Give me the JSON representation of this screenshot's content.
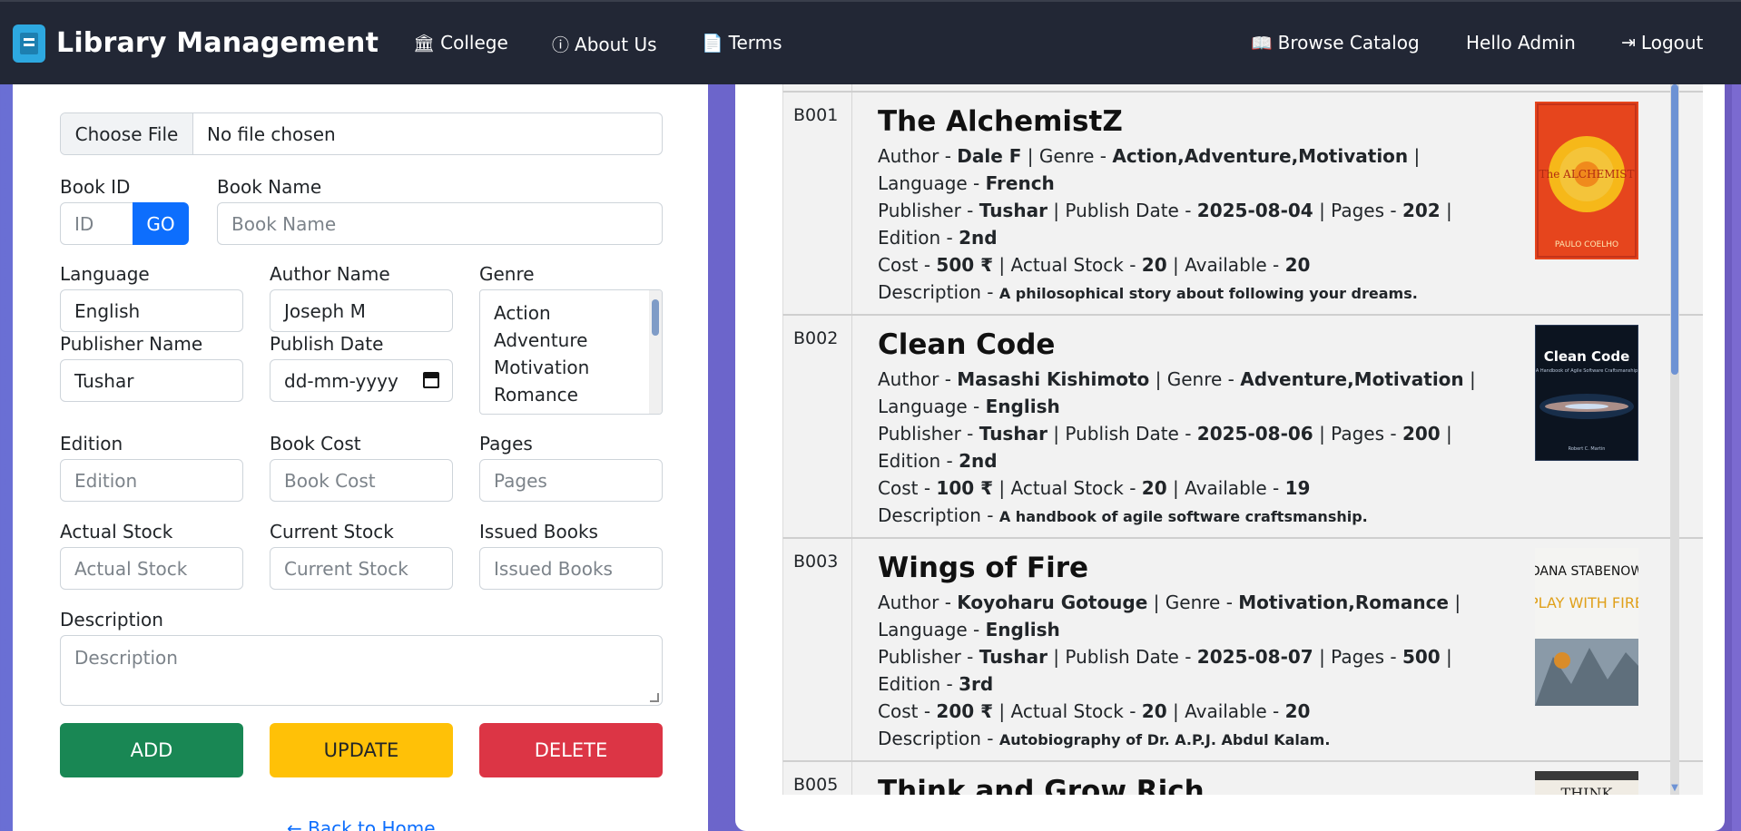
{
  "navbar": {
    "brand": "Library Management",
    "links": [
      {
        "label": "College",
        "icon": "bank-icon"
      },
      {
        "label": "About Us",
        "icon": "info-circle-icon"
      },
      {
        "label": "Terms",
        "icon": "file-text-icon"
      }
    ],
    "browse": "Browse Catalog",
    "greeting": "Hello Admin",
    "logout": "Logout"
  },
  "form": {
    "file_button": "Choose File",
    "file_status": "No file chosen",
    "book_id_label": "Book ID",
    "book_id_placeholder": "ID",
    "go_button": "GO",
    "book_name_label": "Book Name",
    "book_name_placeholder": "Book Name",
    "language_label": "Language",
    "language_value": "English",
    "author_label": "Author Name",
    "author_value": "Joseph M",
    "genre_label": "Genre",
    "genre_options": [
      "Action",
      "Adventure",
      "Motivation",
      "Romance"
    ],
    "publisher_label": "Publisher Name",
    "publisher_value": "Tushar",
    "publish_date_label": "Publish Date",
    "publish_date_placeholder": "dd-mm-yyyy",
    "edition_label": "Edition",
    "edition_placeholder": "Edition",
    "cost_label": "Book Cost",
    "cost_placeholder": "Book Cost",
    "pages_label": "Pages",
    "pages_placeholder": "Pages",
    "actual_stock_label": "Actual Stock",
    "actual_stock_placeholder": "Actual Stock",
    "current_stock_label": "Current Stock",
    "current_stock_placeholder": "Current Stock",
    "issued_label": "Issued Books",
    "issued_placeholder": "Issued Books",
    "description_label": "Description",
    "description_placeholder": "Description",
    "add_button": "ADD",
    "update_button": "UPDATE",
    "delete_button": "DELETE",
    "back_link": "Back to Home"
  },
  "colors": {
    "navbar": "#222735",
    "primary": "#0d6efd",
    "add": "#198754",
    "update": "#ffc107",
    "delete": "#dc3545"
  },
  "books": [
    {
      "id": "B001",
      "title": "The AlchemistZ",
      "author": "Dale F",
      "genre": "Action,Adventure,Motivation",
      "language": "French",
      "publisher": "Tushar",
      "publish_date": "2025-08-04",
      "pages": "202",
      "edition": "2nd",
      "cost": "500 ₹",
      "actual_stock": "20",
      "available": "20",
      "description": "A philosophical story about following your dreams.",
      "cover": {
        "name": "alchemist-cover",
        "title": "The ALCHEMIST",
        "author": "PAULO COELHO"
      }
    },
    {
      "id": "B002",
      "title": "Clean Code",
      "author": "Masashi Kishimoto",
      "genre": "Adventure,Motivation",
      "language": "English",
      "publisher": "Tushar",
      "publish_date": "2025-08-06",
      "pages": "200",
      "edition": "2nd",
      "cost": "100 ₹",
      "actual_stock": "20",
      "available": "19",
      "description": "A handbook of agile software craftsmanship.",
      "cover": {
        "name": "clean-code-cover",
        "title": "Clean Code",
        "subtitle": "A Handbook of Agile Software Craftsmanship",
        "author": "Robert C. Martin"
      }
    },
    {
      "id": "B003",
      "title": "Wings of Fire",
      "author": "Koyoharu Gotouge",
      "genre": "Motivation,Romance",
      "language": "English",
      "publisher": "Tushar",
      "publish_date": "2025-08-07",
      "pages": "500",
      "edition": "3rd",
      "cost": "200 ₹",
      "actual_stock": "20",
      "available": "20",
      "description": "Autobiography of Dr. A.P.J. Abdul Kalam.",
      "cover": {
        "name": "play-with-fire-cover",
        "author": "DANA STABENOW",
        "title": "PLAY WITH FIRE"
      }
    },
    {
      "id": "B005",
      "title": "Think and Grow Rich",
      "cover": {
        "name": "think-grow-rich-cover",
        "title": "THINK"
      }
    }
  ],
  "field_prefix": {
    "author": "Author - ",
    "genre": "Genre - ",
    "language": "Language - ",
    "publisher": "Publisher - ",
    "publish_date": "Publish Date - ",
    "pages": "Pages - ",
    "edition": "Edition - ",
    "cost": "Cost - ",
    "actual_stock": "Actual Stock - ",
    "available": "Available - ",
    "description": "Description - ",
    "sep": " | "
  }
}
